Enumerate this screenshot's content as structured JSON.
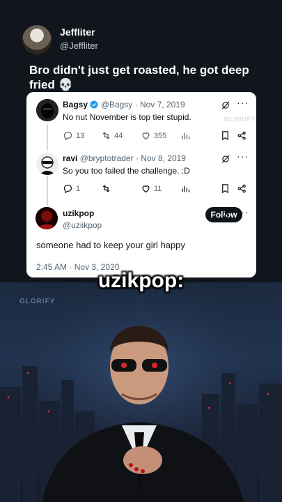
{
  "poster": {
    "name": "Jeffliter",
    "handle": "@Jeffliter"
  },
  "caption": "Bro didn't just get roasted, he got deep fried 💀",
  "watermark": "GLORIFY",
  "tweets": [
    {
      "name": "Bagsy",
      "handle": "@Bagsy",
      "date": "· Nov 7, 2019",
      "text": "No nut November is top tier stupid.",
      "replies": "13",
      "retweets": "44",
      "likes": "355"
    },
    {
      "name": "ravi",
      "handle": "@bryptotrader",
      "date": "· Nov 8, 2019",
      "text": "So you too failed the challenge. :D",
      "replies": "1",
      "retweets": "",
      "likes": "11"
    },
    {
      "name": "uzikpop",
      "handle": "@uziikpop",
      "text": "someone had to keep your girl happy",
      "timestamp": "2:45 AM · Nov 3, 2020",
      "follow_label": "Follow"
    }
  ],
  "overlay_title": "uzikpop:",
  "icons": [
    "verified-badge-icon",
    "grok-icon",
    "more-icon",
    "reply-icon",
    "retweet-icon",
    "like-icon",
    "views-icon",
    "bookmark-icon",
    "share-icon"
  ],
  "colors": {
    "verified": "#1d9bf0",
    "follow_bg": "#0f1419",
    "card": "#ffffff",
    "page_bg": "#11161c"
  }
}
